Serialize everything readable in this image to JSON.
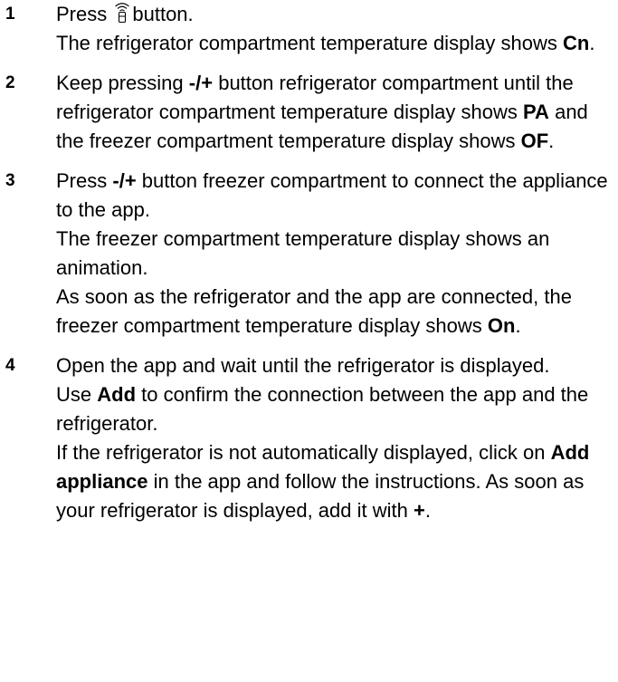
{
  "steps": [
    {
      "number": "1",
      "instruction_prefix": "Press",
      "instruction_icon": "remote-connect-icon",
      "instruction_suffix": "button.",
      "result_prefix": "The refrigerator compartment temperature display shows",
      "result_code": "Cn",
      "result_end": "."
    },
    {
      "number": "2",
      "p1": "Keep pressing",
      "b1": "-/+",
      "p2": "button refrigerator compartment until the refrigerator compartment temperature display shows",
      "b2": "PA",
      "p3": "and the freezer compartment temperature display shows",
      "b3": "OF",
      "p4": "."
    },
    {
      "number": "3",
      "p1": "Press",
      "b1": "-/+",
      "p2": "button freezer compartment to connect the appliance to the app.",
      "line2": "The freezer compartment temperature display shows an animation.",
      "line3_prefix": "As soon as the refrigerator and the app are connected, the freezer compartment temperature display shows",
      "line3_code": "On",
      "line3_end": "."
    },
    {
      "number": "4",
      "line1": "Open the app and wait until the refrigerator is displayed.",
      "line2_p1": "Use",
      "line2_b1": "Add",
      "line2_p2": "to confirm the connection between the app and the refrigerator.",
      "line3_p1": "If the refrigerator is not automatically displayed, click on",
      "line3_b1": "Add appliance",
      "line3_p2": "in the app and follow the instructions. As soon as your refrigerator is displayed, add it with",
      "line3_b2": "+",
      "line3_end": "."
    }
  ]
}
